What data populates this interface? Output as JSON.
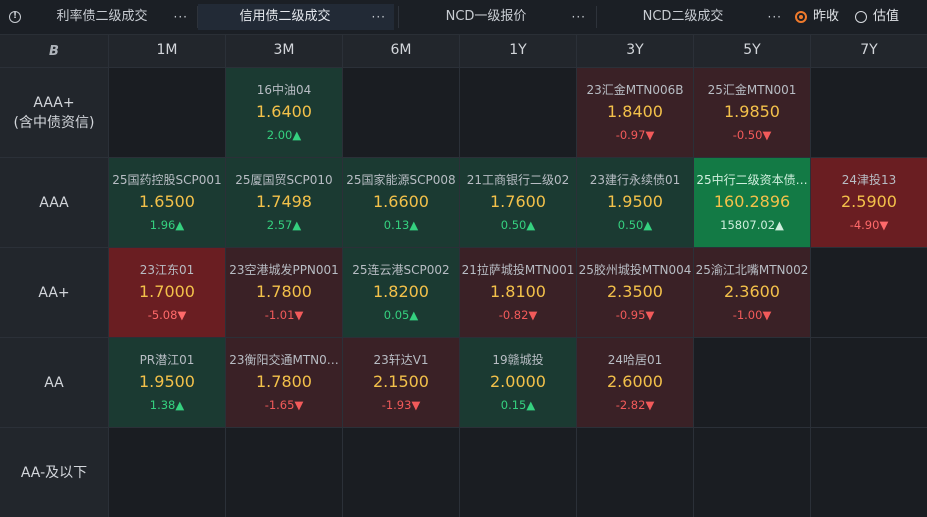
{
  "toolbar": {
    "tabs": [
      {
        "label": "利率债二级成交",
        "more": "···"
      },
      {
        "label": "信用债二级成交",
        "more": "···"
      },
      {
        "label": "NCD一级报价",
        "more": "···"
      },
      {
        "label": "NCD二级成交",
        "more": "···"
      }
    ],
    "radio_options": [
      "昨收",
      "估值"
    ],
    "selected_radio": "昨收"
  },
  "grid": {
    "corner_label": "B",
    "columns": [
      "1M",
      "3M",
      "6M",
      "1Y",
      "3Y",
      "5Y",
      "7Y"
    ],
    "rows": [
      {
        "label_line1": "AAA+",
        "label_line2": "(含中债资信)",
        "cells": [
          null,
          {
            "name": "16中油04",
            "yield": "1.6400",
            "change": "2.00▲",
            "dir": "up",
            "tone": "g"
          },
          null,
          null,
          {
            "name": "23汇金MTN006B",
            "yield": "1.8400",
            "change": "-0.97▼",
            "dir": "down",
            "tone": "r"
          },
          {
            "name": "25汇金MTN001",
            "yield": "1.9850",
            "change": "-0.50▼",
            "dir": "down",
            "tone": "r"
          },
          null
        ]
      },
      {
        "label_line1": "AAA",
        "label_line2": "",
        "cells": [
          {
            "name": "25国药控股SCP001",
            "yield": "1.6500",
            "change": "1.96▲",
            "dir": "up",
            "tone": "g"
          },
          {
            "name": "25厦国贸SCP010",
            "yield": "1.7498",
            "change": "2.57▲",
            "dir": "up",
            "tone": "g"
          },
          {
            "name": "25国家能源SCP008",
            "yield": "1.6600",
            "change": "0.13▲",
            "dir": "up",
            "tone": "g"
          },
          {
            "name": "21工商银行二级02",
            "yield": "1.7600",
            "change": "0.50▲",
            "dir": "up",
            "tone": "g"
          },
          {
            "name": "23建行永续债01",
            "yield": "1.9500",
            "change": "0.50▲",
            "dir": "up",
            "tone": "g"
          },
          {
            "name": "25中行二级资本债…",
            "yield": "160.2896",
            "change": "15807.02▲",
            "dir": "up",
            "tone": "gb"
          },
          {
            "name": "24津投13",
            "yield": "2.5900",
            "change": "-4.90▼",
            "dir": "down",
            "tone": "rb"
          }
        ]
      },
      {
        "label_line1": "AA+",
        "label_line2": "",
        "cells": [
          {
            "name": "23江东01",
            "yield": "1.7000",
            "change": "-5.08▼",
            "dir": "down",
            "tone": "rb"
          },
          {
            "name": "23空港城发PPN001",
            "yield": "1.7800",
            "change": "-1.01▼",
            "dir": "down",
            "tone": "r"
          },
          {
            "name": "25连云港SCP002",
            "yield": "1.8200",
            "change": "0.05▲",
            "dir": "up",
            "tone": "g"
          },
          {
            "name": "21拉萨城投MTN001",
            "yield": "1.8100",
            "change": "-0.82▼",
            "dir": "down",
            "tone": "r"
          },
          {
            "name": "25胶州城投MTN004",
            "yield": "2.3500",
            "change": "-0.95▼",
            "dir": "down",
            "tone": "r"
          },
          {
            "name": "25渝江北嘴MTN002",
            "yield": "2.3600",
            "change": "-1.00▼",
            "dir": "down",
            "tone": "r"
          },
          null
        ]
      },
      {
        "label_line1": "AA",
        "label_line2": "",
        "cells": [
          {
            "name": "PR潜江01",
            "yield": "1.9500",
            "change": "1.38▲",
            "dir": "up",
            "tone": "g"
          },
          {
            "name": "23衡阳交通MTN0…",
            "yield": "1.7800",
            "change": "-1.65▼",
            "dir": "down",
            "tone": "r"
          },
          {
            "name": "23轩达V1",
            "yield": "2.1500",
            "change": "-1.93▼",
            "dir": "down",
            "tone": "r"
          },
          {
            "name": "19赣城投",
            "yield": "2.0000",
            "change": "0.15▲",
            "dir": "up",
            "tone": "g"
          },
          {
            "name": "24哈居01",
            "yield": "2.6000",
            "change": "-2.82▼",
            "dir": "down",
            "tone": "r"
          },
          null,
          null
        ]
      },
      {
        "label_line1": "AA-及以下",
        "label_line2": "",
        "cells": [
          null,
          null,
          null,
          null,
          null,
          null,
          null
        ]
      }
    ]
  },
  "colors": {
    "accent_radio": "#f07a2c",
    "yield_text": "#f3c14a",
    "up": "#35d07f",
    "down": "#f25a5a",
    "up_cell": "#1b3a32",
    "down_cell": "#3a2126",
    "strong_up_cell": "#137a45",
    "strong_down_cell": "#6a1e22"
  }
}
